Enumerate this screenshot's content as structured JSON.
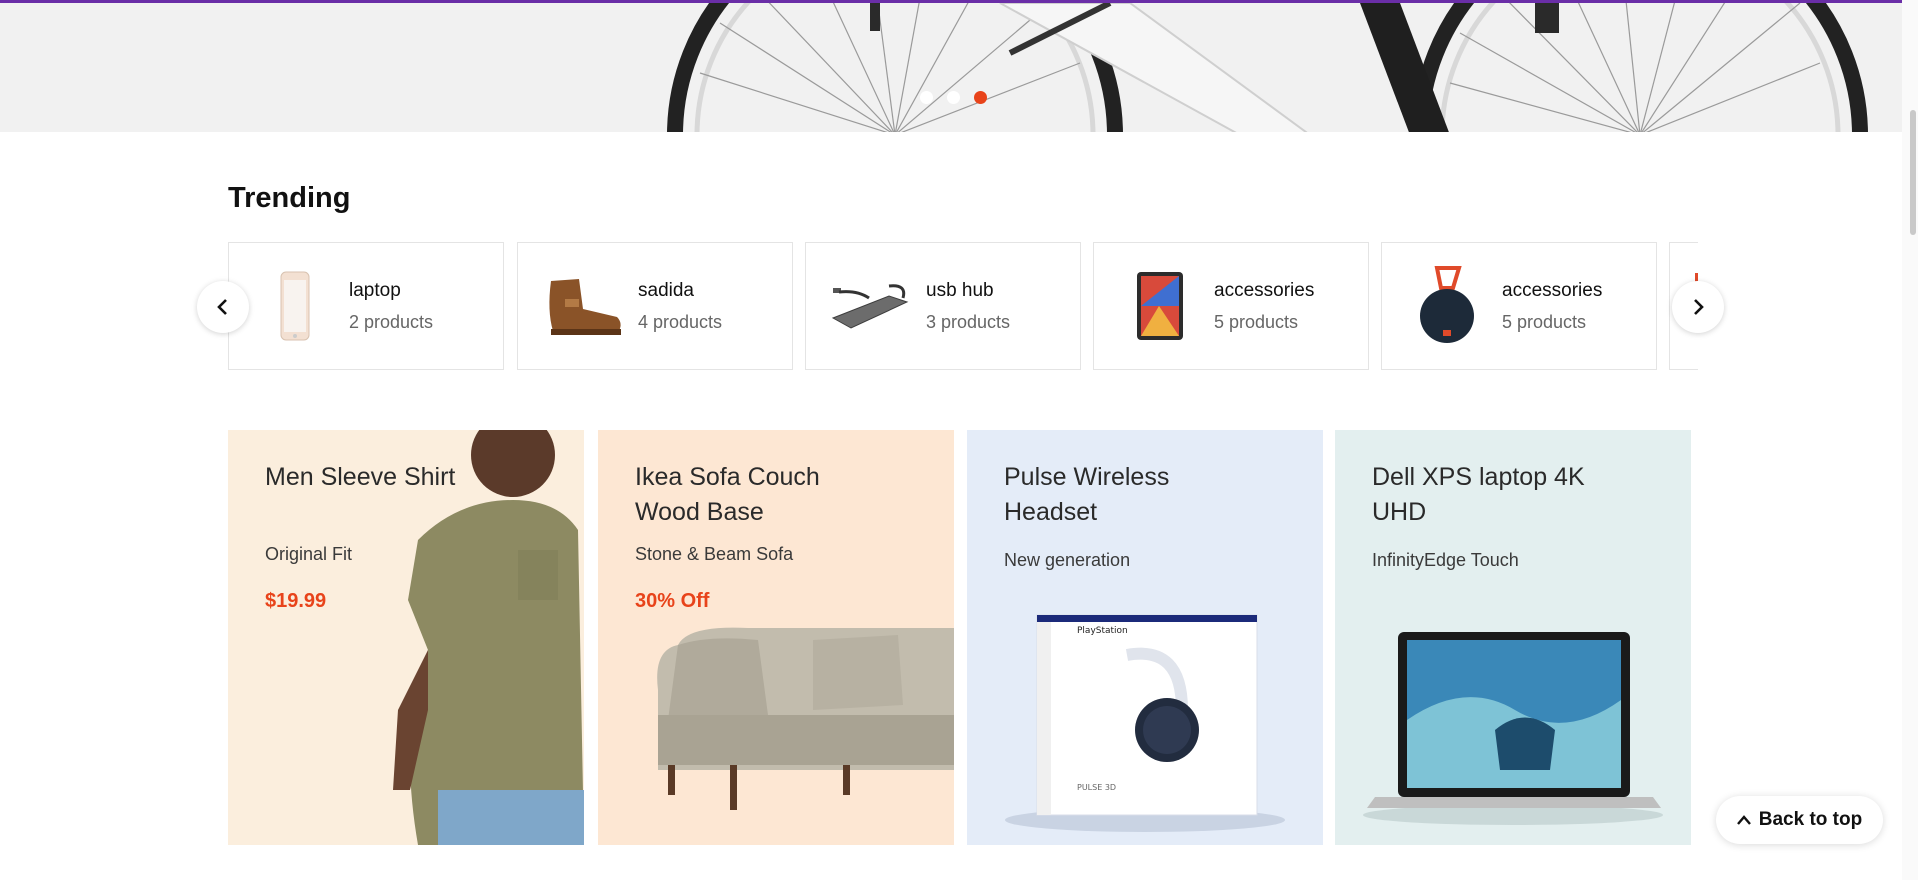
{
  "hero": {
    "slides": [
      {
        "active": false
      },
      {
        "active": false
      },
      {
        "active": true
      }
    ],
    "accent_color": "#e8431a",
    "top_border_color": "#6a2ea7"
  },
  "trending": {
    "title": "Trending",
    "items": [
      {
        "name": "laptop",
        "count": "2 products",
        "icon": "phone-thumbnail"
      },
      {
        "name": "sadida",
        "count": "4 products",
        "icon": "boot-thumbnail"
      },
      {
        "name": "usb hub",
        "count": "3 products",
        "icon": "usb-hub-thumbnail"
      },
      {
        "name": "accessories",
        "count": "5 products",
        "icon": "tablet-thumbnail"
      },
      {
        "name": "accessories",
        "count": "5 products",
        "icon": "speaker-thumbnail"
      }
    ],
    "prev_icon": "chevron-left-icon",
    "next_icon": "chevron-right-icon"
  },
  "promos": [
    {
      "title": "Men Sleeve Shirt",
      "subtitle": "Original Fit",
      "price": "$19.99",
      "bg": "#fbeedd"
    },
    {
      "title": "Ikea Sofa Couch Wood Base",
      "subtitle": "Stone & Beam Sofa",
      "price": "30% Off",
      "bg": "#fde7d3"
    },
    {
      "title": "Pulse Wireless Headset",
      "subtitle": "New generation",
      "price": "",
      "bg": "#e4ecf8"
    },
    {
      "title": "Dell XPS laptop 4K UHD",
      "subtitle": "InfinityEdge Touch",
      "price": "",
      "bg": "#e3efef"
    }
  ],
  "back_to_top": {
    "label": "Back to top",
    "icon": "chevron-up-icon"
  }
}
